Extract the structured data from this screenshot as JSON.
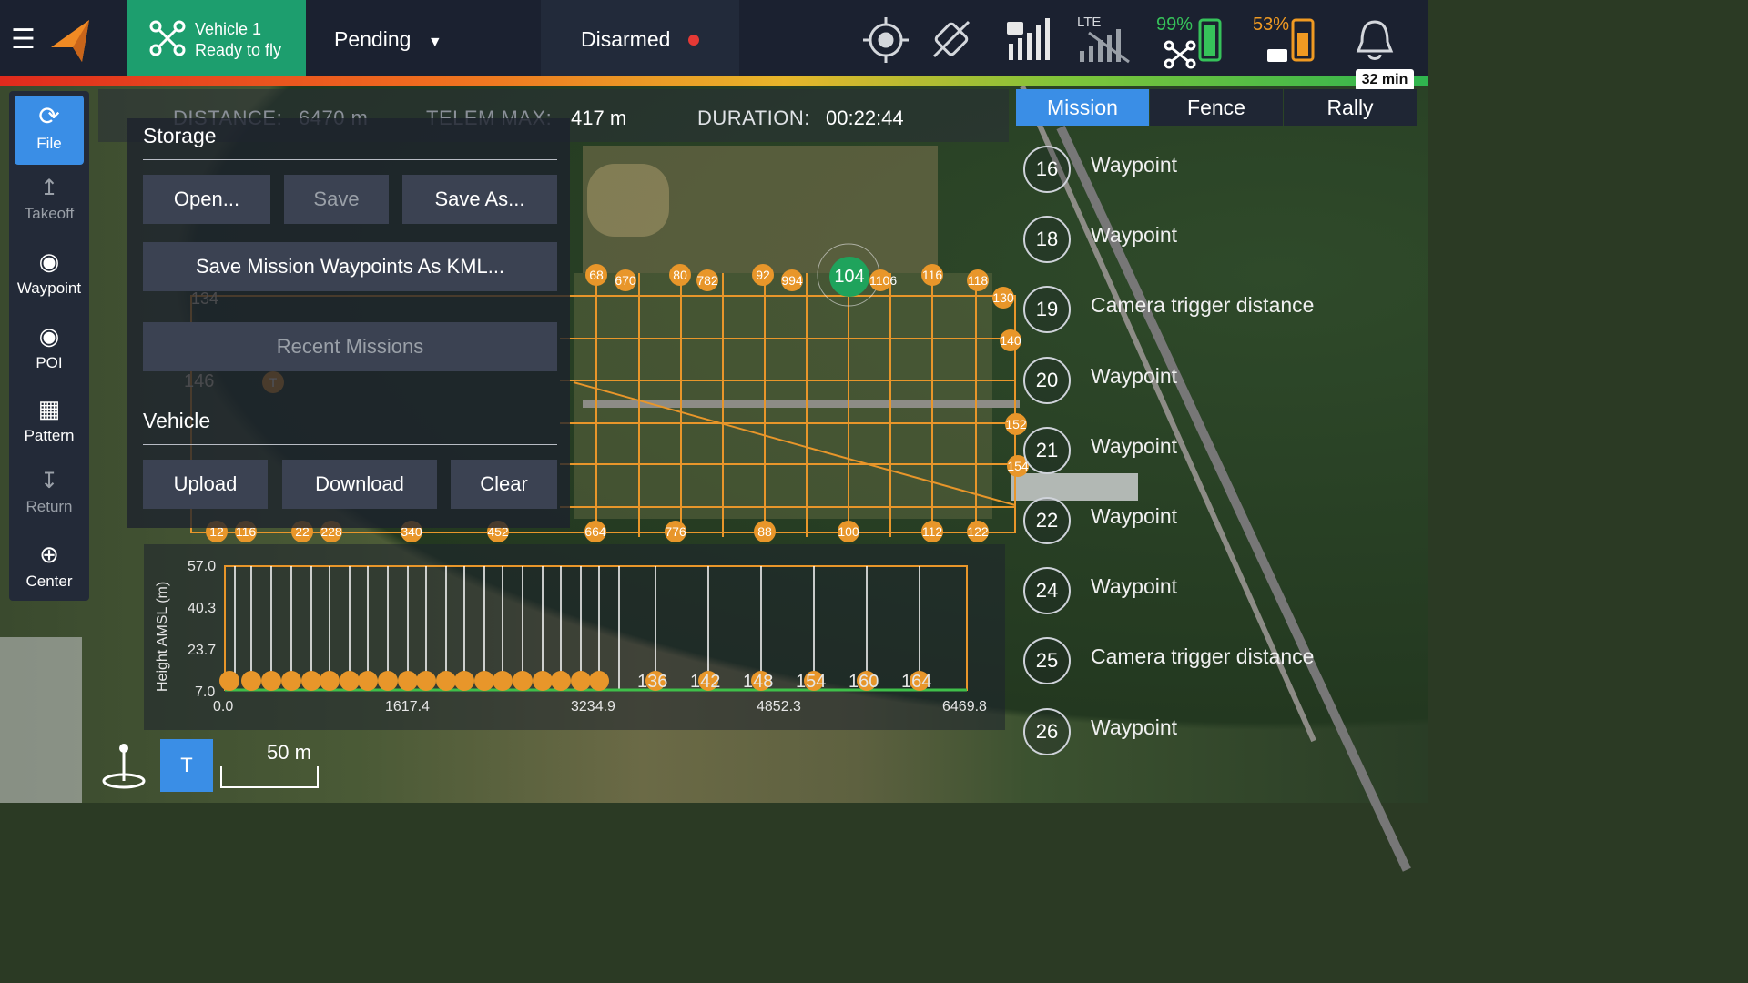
{
  "colors": {
    "accent": "#3a8ee6",
    "vehicle_green": "#1d9e6e",
    "mission_orange": "#e8962a",
    "disarmed_red": "#e53935"
  },
  "toolbar": {
    "vehicle_name": "Vehicle 1",
    "vehicle_status": "Ready to fly",
    "flight_mode": "Pending",
    "arm_state": "Disarmed",
    "lte_label": "LTE",
    "vehicle_battery": "99%",
    "rc_battery": "53%",
    "flight_time": "32 min",
    "icons": [
      "menu-icon",
      "logo-icon",
      "drone-icon",
      "gps-icon",
      "no-vehicle-icon",
      "rc-signal-icon",
      "lte-signal-icon",
      "drone-battery-icon",
      "rc-battery-icon",
      "notification-bell-icon"
    ]
  },
  "stats": {
    "distance_label": "DISTANCE:",
    "distance_value": "6470 m",
    "telem_label": "TELEM MAX:",
    "telem_value": "417 m",
    "duration_label": "DURATION:",
    "duration_value": "00:22:44"
  },
  "toolstrip": [
    {
      "label": "File",
      "icon": "sync-icon",
      "active": true
    },
    {
      "label": "Takeoff",
      "icon": "takeoff-icon",
      "disabled": true
    },
    {
      "label": "Waypoint",
      "icon": "waypoint-add-icon"
    },
    {
      "label": "POI",
      "icon": "poi-add-icon"
    },
    {
      "label": "Pattern",
      "icon": "pattern-icon"
    },
    {
      "label": "Return",
      "icon": "return-icon",
      "disabled": true
    },
    {
      "label": "Center",
      "icon": "center-icon"
    }
  ],
  "plan": {
    "storage_title": "Storage",
    "open": "Open...",
    "save": "Save",
    "save_as": "Save As...",
    "save_kml": "Save Mission Waypoints As KML...",
    "recent": "Recent Missions",
    "vehicle_title": "Vehicle",
    "upload": "Upload",
    "download": "Download",
    "clear": "Clear"
  },
  "tabs": {
    "mission": "Mission",
    "fence": "Fence",
    "rally": "Rally"
  },
  "mission_items": [
    {
      "num": "16",
      "label": "Waypoint"
    },
    {
      "num": "18",
      "label": "Waypoint"
    },
    {
      "num": "19",
      "label": "Camera trigger distance"
    },
    {
      "num": "20",
      "label": "Waypoint"
    },
    {
      "num": "21",
      "label": "Waypoint"
    },
    {
      "num": "22",
      "label": "Waypoint"
    },
    {
      "num": "24",
      "label": "Waypoint"
    },
    {
      "num": "25",
      "label": "Camera trigger distance"
    },
    {
      "num": "26",
      "label": "Waypoint"
    }
  ],
  "elevation": {
    "ylabel": "Height AMSL (m)",
    "yticks": [
      "57.0",
      "40.3",
      "23.7",
      "7.0"
    ],
    "xticks": [
      "0.0",
      "1617.4",
      "3234.9",
      "4852.3",
      "6469.8"
    ],
    "marker_labels": [
      "136",
      "142",
      "148",
      "154",
      "160",
      "164"
    ]
  },
  "map": {
    "scale": "50 m",
    "selected_waypoint": "104",
    "top_labels": [
      "68",
      "670",
      "80",
      "782",
      "92",
      "994",
      "1106",
      "116",
      "118"
    ],
    "bottom_labels": [
      "12",
      "116",
      "22",
      "228",
      "340",
      "452",
      "664",
      "776",
      "88",
      "100",
      "112",
      "122"
    ],
    "right_labels": [
      "130",
      "140",
      "152",
      "154"
    ],
    "left_labels": [
      "134",
      "146",
      "T"
    ],
    "takeoff_label": "T"
  }
}
